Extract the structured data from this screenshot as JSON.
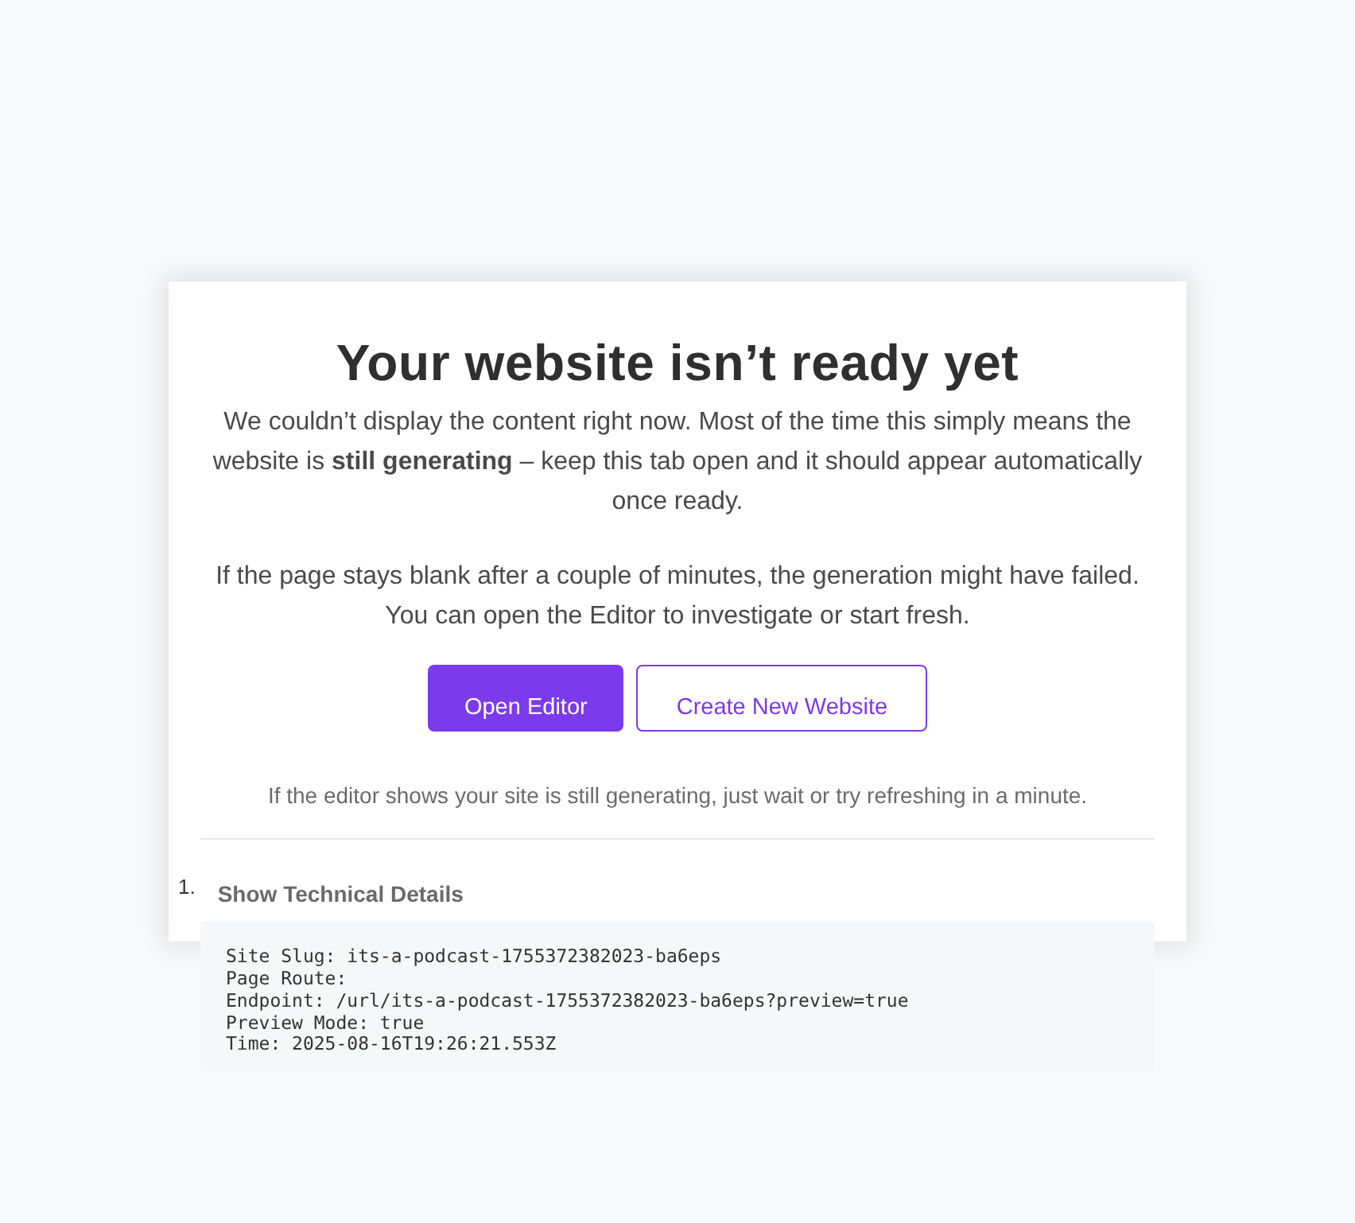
{
  "title": "Your website isn’t ready yet",
  "paragraphs": [
    "We couldn’t display the content right now. Most of the time this simply means the website is **still generating** – keep this tab open and it should appear automatically once ready.",
    "If the page stays blank after a couple of minutes, the generation might have failed. You can open the Editor to investigate or start fresh."
  ],
  "buttons": [
    {
      "label": "Open Editor",
      "kind": "primary"
    },
    {
      "label": "Create New Website",
      "kind": "outline"
    }
  ],
  "note": "If the editor shows your site is still generating, just wait or try refreshing in a minute.",
  "details": {
    "marker": "1.",
    "summary": "Show Technical Details",
    "lines": [
      "Site Slug: its-a-podcast-1755372382023-ba6eps",
      "Page Route:",
      "Endpoint: /url/its-a-podcast-1755372382023-ba6eps?preview=true",
      "Preview Mode: true",
      "Time: 2025-08-16T19:26:21.553Z"
    ]
  }
}
